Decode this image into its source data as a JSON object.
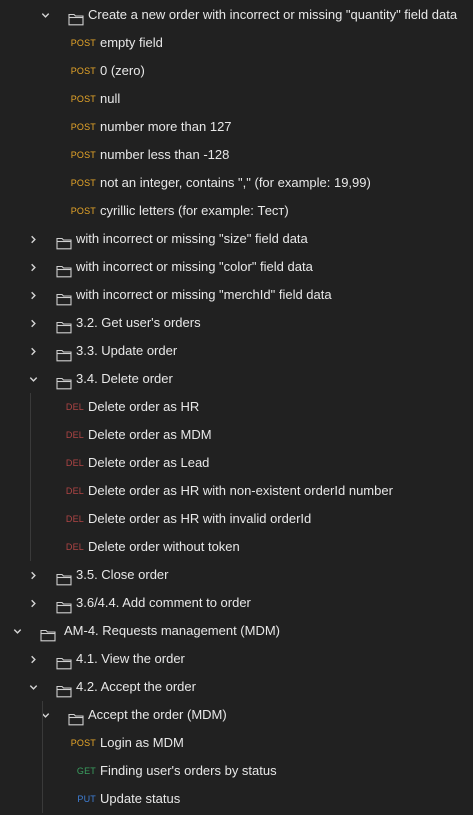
{
  "tree": {
    "rows": [
      {
        "kind": "folder",
        "expanded": true,
        "depth": 2,
        "label": "Create a new order with incorrect or missing \"quantity\" field data"
      },
      {
        "kind": "request",
        "method": "POST",
        "depth": 3,
        "label": "empty field"
      },
      {
        "kind": "request",
        "method": "POST",
        "depth": 3,
        "label": "0 (zero)"
      },
      {
        "kind": "request",
        "method": "POST",
        "depth": 3,
        "label": "null"
      },
      {
        "kind": "request",
        "method": "POST",
        "depth": 3,
        "label": "number more than 127"
      },
      {
        "kind": "request",
        "method": "POST",
        "depth": 3,
        "label": "number less than -128"
      },
      {
        "kind": "request",
        "method": "POST",
        "depth": 3,
        "label": "not an integer, contains \",\" (for example: 19,99)"
      },
      {
        "kind": "request",
        "method": "POST",
        "depth": 3,
        "label": "cyrillic letters (for example: Тест)"
      },
      {
        "kind": "folder",
        "expanded": false,
        "depth": 1,
        "label": "with incorrect or missing \"size\" field data"
      },
      {
        "kind": "folder",
        "expanded": false,
        "depth": 1,
        "label": "with incorrect or missing \"color\" field data"
      },
      {
        "kind": "folder",
        "expanded": false,
        "depth": 1,
        "label": "with incorrect or missing \"merchId\" field data"
      },
      {
        "kind": "folder",
        "expanded": false,
        "depth": 1,
        "label": "3.2. Get user's orders"
      },
      {
        "kind": "folder",
        "expanded": false,
        "depth": 1,
        "label": "3.3. Update order"
      },
      {
        "kind": "folder",
        "expanded": true,
        "depth": 1,
        "label": "3.4. Delete order"
      },
      {
        "kind": "request",
        "method": "DEL",
        "depth": 2,
        "label": "Delete order as HR"
      },
      {
        "kind": "request",
        "method": "DEL",
        "depth": 2,
        "label": "Delete order as MDM"
      },
      {
        "kind": "request",
        "method": "DEL",
        "depth": 2,
        "label": "Delete order as Lead"
      },
      {
        "kind": "request",
        "method": "DEL",
        "depth": 2,
        "label": "Delete order as HR with non-existent orderId number"
      },
      {
        "kind": "request",
        "method": "DEL",
        "depth": 2,
        "label": "Delete order as HR with invalid orderId"
      },
      {
        "kind": "request",
        "method": "DEL",
        "depth": 2,
        "label": "Delete order without token"
      },
      {
        "kind": "folder",
        "expanded": false,
        "depth": 1,
        "label": "3.5. Close order"
      },
      {
        "kind": "folder",
        "expanded": false,
        "depth": 1,
        "label": "3.6/4.4. Add comment to order"
      },
      {
        "kind": "folder",
        "expanded": true,
        "depth": 0,
        "label": "AM-4. Requests management (MDM)"
      },
      {
        "kind": "folder",
        "expanded": false,
        "depth": 1,
        "label": "4.1. View the order"
      },
      {
        "kind": "folder",
        "expanded": true,
        "depth": 1,
        "label": "4.2. Accept the order"
      },
      {
        "kind": "folder",
        "expanded": true,
        "depth": 2,
        "label": "Accept the order (MDM)"
      },
      {
        "kind": "request",
        "method": "POST",
        "depth": 3,
        "label": "Login as MDM"
      },
      {
        "kind": "request",
        "method": "GET",
        "depth": 3,
        "label": "Finding user's orders by status"
      },
      {
        "kind": "request",
        "method": "PUT",
        "depth": 3,
        "label": "Update status"
      }
    ]
  }
}
